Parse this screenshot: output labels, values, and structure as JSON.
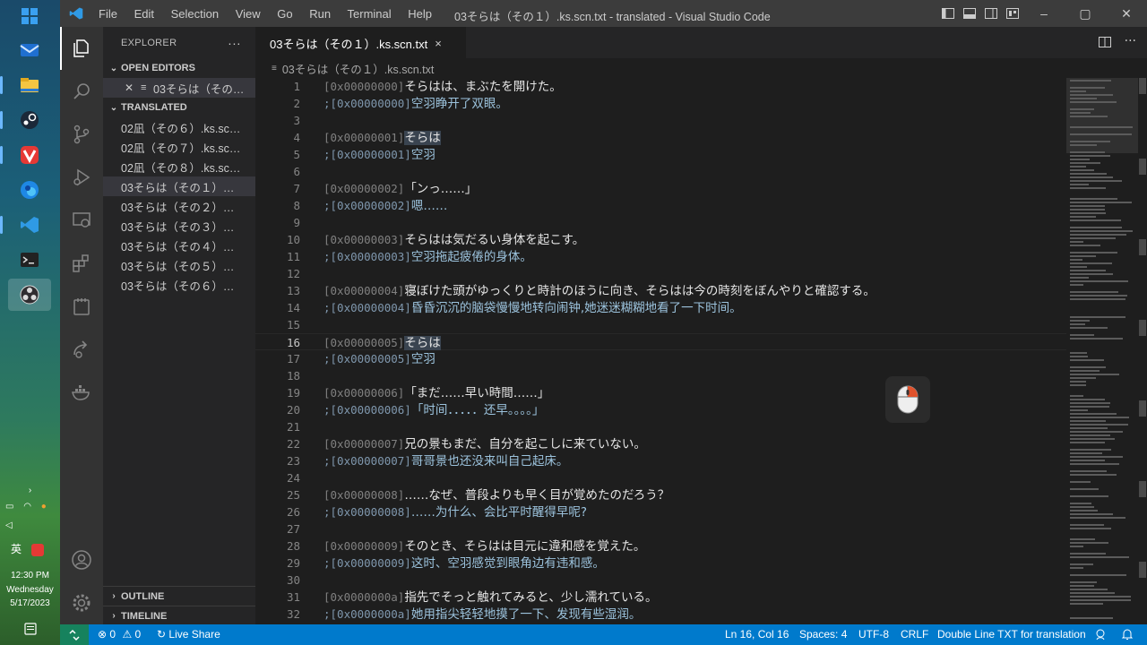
{
  "window": {
    "title": "03そらは（その１）.ks.scn.txt - translated - Visual Studio Code",
    "menu": [
      "File",
      "Edit",
      "Selection",
      "View",
      "Go",
      "Run",
      "Terminal",
      "Help"
    ]
  },
  "taskbar": {
    "time": "12:30 PM",
    "day": "Wednesday",
    "date": "5/17/2023",
    "ime": "英"
  },
  "sidebar": {
    "header": "EXPLORER",
    "more": "···",
    "open_editors_label": "OPEN EDITORS",
    "open_editor_file": "03そらは（その…",
    "folder_label": "TRANSLATED",
    "files": [
      "02凪（その６）.ks.sc…",
      "02凪（その７）.ks.sc…",
      "02凪（その８）.ks.sc…",
      "03そらは（その１）…",
      "03そらは（その２）…",
      "03そらは（その３）…",
      "03そらは（その４）…",
      "03そらは（その５）…",
      "03そらは（その６）…"
    ],
    "outline_label": "OUTLINE",
    "timeline_label": "TIMELINE"
  },
  "tab": {
    "label": "03そらは（その１）.ks.scn.txt",
    "close": "×"
  },
  "breadcrumb": "03そらは（その１）.ks.scn.txt",
  "editor": {
    "current_line": 16,
    "lines": [
      {
        "n": "1",
        "addr": "[0x00000000]",
        "text": "そらはは、まぶたを開けた。",
        "kind": "jp"
      },
      {
        "n": "2",
        "addr": ";[0x00000000]",
        "text": "空羽睁开了双眼。",
        "kind": "cn"
      },
      {
        "n": "3",
        "addr": "",
        "text": "",
        "kind": "jp"
      },
      {
        "n": "4",
        "addr": "[0x00000001]",
        "text": "そらは",
        "kind": "jp"
      },
      {
        "n": "5",
        "addr": ";[0x00000001]",
        "text": "空羽",
        "kind": "cn"
      },
      {
        "n": "6",
        "addr": "",
        "text": "",
        "kind": "jp"
      },
      {
        "n": "7",
        "addr": "[0x00000002]",
        "text": "「ンっ……」",
        "kind": "jp"
      },
      {
        "n": "8",
        "addr": ";[0x00000002]",
        "text": "嗯……",
        "kind": "cn"
      },
      {
        "n": "9",
        "addr": "",
        "text": "",
        "kind": "jp"
      },
      {
        "n": "10",
        "addr": "[0x00000003]",
        "text": "そらはは気だるい身体を起こす。",
        "kind": "jp"
      },
      {
        "n": "11",
        "addr": ";[0x00000003]",
        "text": "空羽拖起疲倦的身体。",
        "kind": "cn"
      },
      {
        "n": "12",
        "addr": "",
        "text": "",
        "kind": "jp"
      },
      {
        "n": "13",
        "addr": "[0x00000004]",
        "text": "寝ぼけた頭がゆっくりと時計のほうに向き、そらはは今の時刻をぼんやりと確認する。",
        "kind": "jp"
      },
      {
        "n": "14",
        "addr": ";[0x00000004]",
        "text": "昏昏沉沉的脑袋慢慢地转向闹钟,她迷迷糊糊地看了一下时间。",
        "kind": "cn"
      },
      {
        "n": "15",
        "addr": "",
        "text": "",
        "kind": "jp"
      },
      {
        "n": "16",
        "addr": "[0x00000005]",
        "text": "そらは",
        "kind": "jp"
      },
      {
        "n": "17",
        "addr": ";[0x00000005]",
        "text": "空羽",
        "kind": "cn"
      },
      {
        "n": "18",
        "addr": "",
        "text": "",
        "kind": "jp"
      },
      {
        "n": "19",
        "addr": "[0x00000006]",
        "text": "「まだ……早い時間……」",
        "kind": "jp"
      },
      {
        "n": "20",
        "addr": ";[0x00000006]",
        "text": "「时间．．．．．还早。。。。」",
        "kind": "cn"
      },
      {
        "n": "21",
        "addr": "",
        "text": "",
        "kind": "jp"
      },
      {
        "n": "22",
        "addr": "[0x00000007]",
        "text": "兄の景もまだ、自分を起こしに来ていない。",
        "kind": "jp"
      },
      {
        "n": "23",
        "addr": ";[0x00000007]",
        "text": "哥哥景也还没来叫自己起床。",
        "kind": "cn"
      },
      {
        "n": "24",
        "addr": "",
        "text": "",
        "kind": "jp"
      },
      {
        "n": "25",
        "addr": "[0x00000008]",
        "text": "……なぜ、普段よりも早く目が覚めたのだろう？",
        "kind": "jp"
      },
      {
        "n": "26",
        "addr": ";[0x00000008]",
        "text": "……为什么、会比平时醒得早呢?",
        "kind": "cn"
      },
      {
        "n": "27",
        "addr": "",
        "text": "",
        "kind": "jp"
      },
      {
        "n": "28",
        "addr": "[0x00000009]",
        "text": "そのとき、そらはは目元に違和感を覚えた。",
        "kind": "jp"
      },
      {
        "n": "29",
        "addr": ";[0x00000009]",
        "text": "这时、空羽感觉到眼角边有违和感。",
        "kind": "cn"
      },
      {
        "n": "30",
        "addr": "",
        "text": "",
        "kind": "jp"
      },
      {
        "n": "31",
        "addr": "[0x0000000a]",
        "text": "指先でそっと触れてみると、少し濡れている。",
        "kind": "jp"
      },
      {
        "n": "32",
        "addr": ";[0x0000000a]",
        "text": "她用指尖轻轻地摸了一下、发现有些湿润。",
        "kind": "cn"
      }
    ]
  },
  "statusbar": {
    "errors": "0",
    "warnings": "0",
    "live_share": "Live Share",
    "position": "Ln 16, Col 16",
    "spaces": "Spaces: 4",
    "encoding": "UTF-8",
    "eol": "CRLF",
    "language": "Double Line TXT for translation"
  },
  "colors": {
    "statusbar": "#007acc",
    "remote": "#16825d",
    "activity_bar": "#333333",
    "sidebar": "#252526",
    "editor": "#1e1e1e"
  }
}
